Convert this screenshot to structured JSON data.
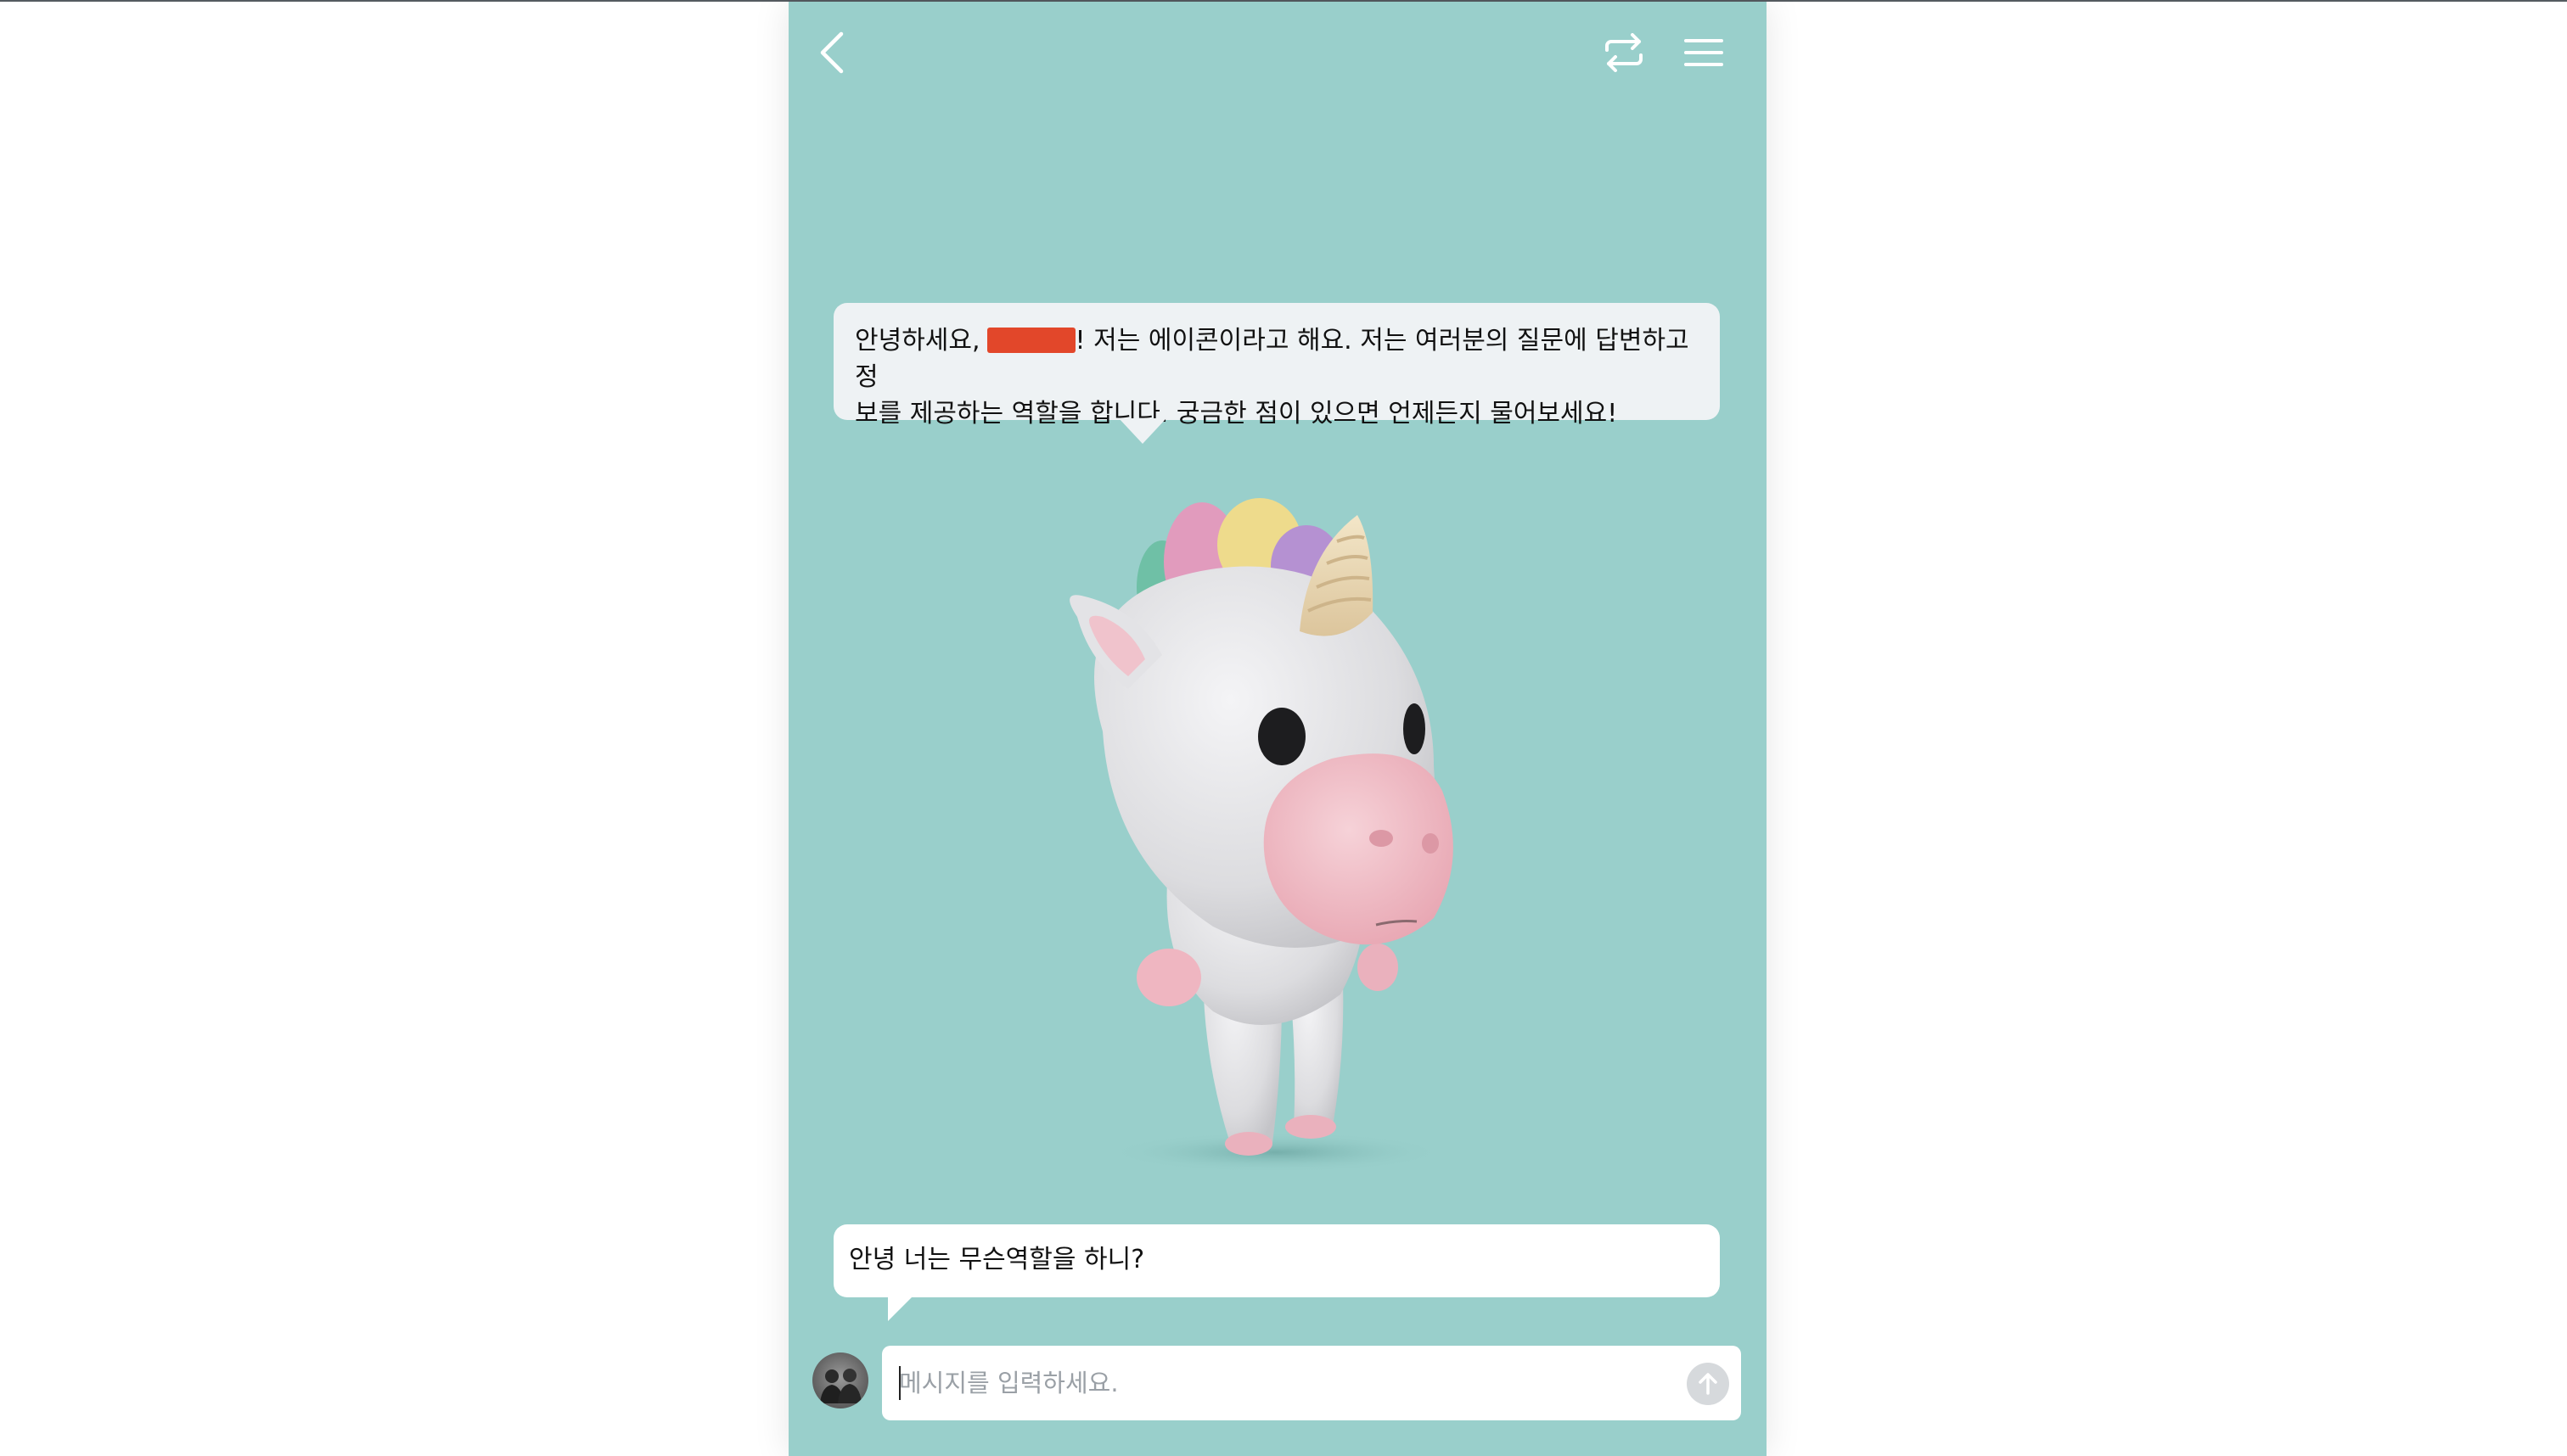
{
  "header": {
    "back_icon": "chevron-left-icon",
    "switch_icon": "repeat-icon",
    "menu_icon": "hamburger-menu-icon"
  },
  "conversation": {
    "bot_message": {
      "prefix": "안녕하세요,",
      "redacted_name": "",
      "line1_rest": "! 저는 에이콘이라고 해요. 저는 여러분의 질문에 답변하고 정",
      "line2": "보를 제공하는 역할을 합니다. 궁금한 점이 있으면 언제든지 물어보세요!"
    },
    "user_message": "안녕 너는 무슨역할을 하니?"
  },
  "composer": {
    "placeholder": "메시지를 입력하세요.",
    "value": "",
    "send_icon": "arrow-up-icon"
  },
  "colors": {
    "background": "#99cfcb",
    "bot_bubble": "#eef2f4",
    "user_bubble": "#ffffff",
    "redaction": "#e2472a"
  }
}
